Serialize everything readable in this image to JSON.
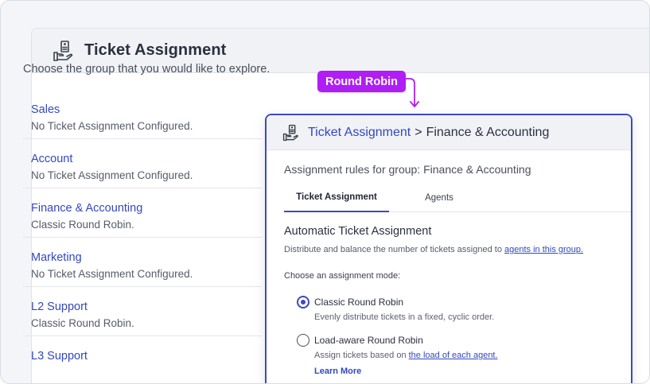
{
  "panel": {
    "title": "Ticket Assignment",
    "intro": "Choose the group that you would like to explore."
  },
  "groups": [
    {
      "name": "Sales",
      "status": "No Ticket Assignment Configured."
    },
    {
      "name": "Account",
      "status": "No Ticket Assignment Configured."
    },
    {
      "name": "Finance & Accounting",
      "status": "Classic Round Robin."
    },
    {
      "name": "Marketing",
      "status": "No Ticket Assignment Configured."
    },
    {
      "name": "L2 Support",
      "status": "Classic Round Robin."
    },
    {
      "name": "L3 Support",
      "status": ""
    }
  ],
  "annotation": {
    "label": "Round Robin",
    "color": "#b01df5"
  },
  "card": {
    "breadcrumb_link": "Ticket Assignment",
    "breadcrumb_sep": ">",
    "breadcrumb_current": "Finance & Accounting",
    "subtitle": "Assignment rules for group: Finance & Accounting",
    "tabs": [
      {
        "label": "Ticket Assignment",
        "active": true
      },
      {
        "label": "Agents",
        "active": false
      }
    ],
    "section_title": "Automatic Ticket Assignment",
    "section_desc_prefix": "Distribute and balance the number of tickets assigned to ",
    "section_desc_link": "agents in this group.",
    "mode_label": "Choose an assignment mode:",
    "options": [
      {
        "label": "Classic Round Robin",
        "desc": "Evenly distribute tickets in a fixed, cyclic order.",
        "selected": true
      },
      {
        "label": "Load-aware Round Robin",
        "desc_prefix": "Assign tickets based on ",
        "desc_link": "the load of each agent.",
        "learn_more": "Learn More",
        "selected": false
      }
    ]
  },
  "colors": {
    "accent": "#3d4ac0",
    "link": "#3347c2",
    "header_bg": "#f1f2f6"
  },
  "icons": {
    "header": "ticket-hand-icon"
  }
}
